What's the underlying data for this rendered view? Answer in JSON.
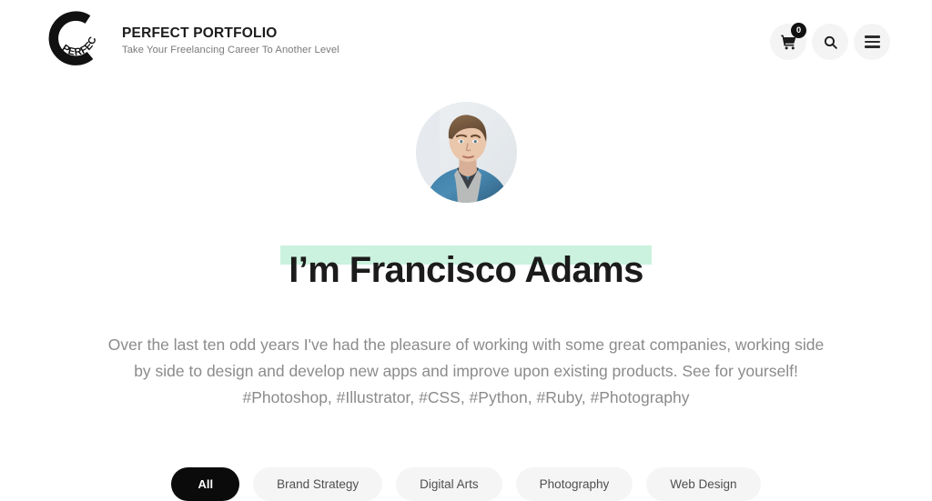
{
  "brand": {
    "logo_icon": "perfect-circle-logo",
    "logo_curved_text": "PERFECT",
    "title": "PERFECT PORTFOLIO",
    "tagline": "Take Your Freelancing Career To Another Level"
  },
  "header": {
    "actions": {
      "cart": {
        "icon": "shopping-cart-icon",
        "badge_count": "0"
      },
      "search": {
        "icon": "search-icon"
      },
      "menu": {
        "icon": "hamburger-menu-icon"
      }
    }
  },
  "hero": {
    "avatar": {
      "icon": "user-portrait-photo",
      "alt": "Portrait of Francisco Adams"
    },
    "headline": "I’m Francisco Adams",
    "headline_highlight_color": "#cbf2de",
    "bio": "Over the last ten odd years I've had the pleasure of working with some great companies, working side by side to design and develop new apps and improve upon existing products. See for yourself!",
    "tags": "#Photoshop, #Illustrator, #CSS, #Python, #Ruby, #Photography"
  },
  "filters": {
    "items": [
      {
        "label": "All",
        "active": true
      },
      {
        "label": "Brand Strategy",
        "active": false
      },
      {
        "label": "Digital Arts",
        "active": false
      },
      {
        "label": "Photography",
        "active": false
      },
      {
        "label": "Web Design",
        "active": false
      }
    ]
  },
  "colors": {
    "page_background": "#ffffff",
    "accent_highlight": "#cbf2de",
    "active_pill": "#0b0b0b",
    "pill_background": "#f5f5f5",
    "body_text": "#8b8b8b",
    "heading_text": "#1b1b1b"
  }
}
